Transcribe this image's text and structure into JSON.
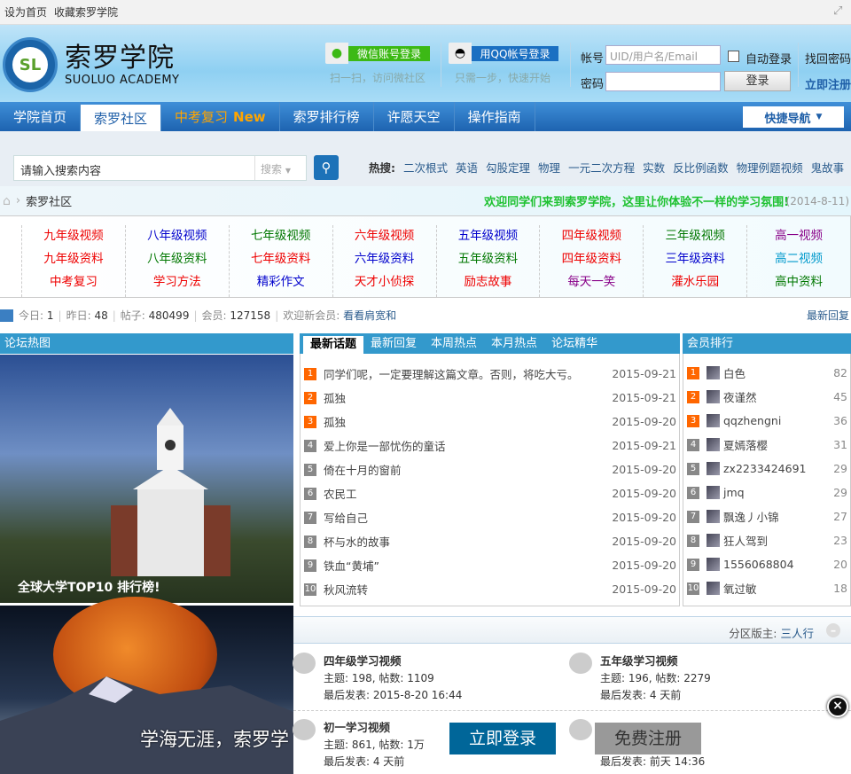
{
  "topbar": {
    "set_home": "设为首页",
    "favorite": "收藏索罗学院"
  },
  "logo": {
    "cn": "索罗学院",
    "en": "SUOLUO ACADEMY",
    "mark": "SL"
  },
  "social": {
    "wechat_label": "微信账号登录",
    "wechat_hint": "扫一扫，访问微社区",
    "qq_label": "用QQ帐号登录",
    "qq_hint": "只需一步，快速开始"
  },
  "login": {
    "account_label": "帐号",
    "account_placeholder": "UID/用户名/Email",
    "password_label": "密码",
    "auto_login": "自动登录",
    "submit": "登录",
    "find_password": "找回密码",
    "register": "立即注册"
  },
  "nav": {
    "items": [
      "学院首页",
      "索罗社区",
      "中考复习",
      "索罗排行榜",
      "许愿天空",
      "操作指南"
    ],
    "new_badge": "New",
    "quick_nav": "快捷导航"
  },
  "search": {
    "placeholder": "请输入搜索内容",
    "type": "搜索",
    "hot_label": "热搜:",
    "hot": [
      "二次根式",
      "英语",
      "勾股定理",
      "物理",
      "一元二次方程",
      "实数",
      "反比例函数",
      "物理例题视频",
      "鬼故事"
    ]
  },
  "breadcrumb": {
    "current": "索罗社区",
    "welcome": "欢迎同学们来到索罗学院，这里让你体验不一样的学习氛围!",
    "date": "(2014-8-11)"
  },
  "links": [
    [
      {
        "t": "九年级视频",
        "c": "#e00"
      },
      {
        "t": "九年级资料",
        "c": "#e00"
      },
      {
        "t": "中考复习",
        "c": "#e00"
      }
    ],
    [
      {
        "t": "八年级视频",
        "c": "#00c"
      },
      {
        "t": "八年级资料",
        "c": "#070"
      },
      {
        "t": "学习方法",
        "c": "#e00"
      }
    ],
    [
      {
        "t": "七年级视频",
        "c": "#070"
      },
      {
        "t": "七年级资料",
        "c": "#e00"
      },
      {
        "t": "精彩作文",
        "c": "#00c"
      }
    ],
    [
      {
        "t": "六年级视频",
        "c": "#e00"
      },
      {
        "t": "六年级资料",
        "c": "#00c"
      },
      {
        "t": "天才小侦探",
        "c": "#e00"
      }
    ],
    [
      {
        "t": "五年级视频",
        "c": "#00c"
      },
      {
        "t": "五年级资料",
        "c": "#070"
      },
      {
        "t": "励志故事",
        "c": "#e00"
      }
    ],
    [
      {
        "t": "四年级视频",
        "c": "#e00"
      },
      {
        "t": "四年级资料",
        "c": "#e00"
      },
      {
        "t": "每天一笑",
        "c": "#808"
      }
    ],
    [
      {
        "t": "三年级视频",
        "c": "#070"
      },
      {
        "t": "三年级资料",
        "c": "#00c"
      },
      {
        "t": "灌水乐园",
        "c": "#e00"
      }
    ],
    [
      {
        "t": "高一视频",
        "c": "#808"
      },
      {
        "t": "高二视频",
        "c": "#09c"
      },
      {
        "t": "高中资料",
        "c": "#070"
      }
    ]
  ],
  "stats": {
    "today_label": "今日:",
    "today": "1",
    "yesterday_label": "昨日:",
    "yesterday": "48",
    "posts_label": "帖子:",
    "posts": "480499",
    "members_label": "会员:",
    "members": "127158",
    "welcome_label": "欢迎新会员:",
    "newest": "看看肩宽和",
    "latest_reply": "最新回复"
  },
  "hotpic": {
    "title": "论坛热图",
    "caption": "全球大学TOP10 排行榜!"
  },
  "topics": {
    "tabs": [
      "最新话题",
      "最新回复",
      "本周热点",
      "本月热点",
      "论坛精华"
    ],
    "items": [
      {
        "n": "1",
        "t": "同学们呢，一定要理解这篇文章。否则，将吃大亏。",
        "d": "2015-09-21"
      },
      {
        "n": "2",
        "t": "孤独",
        "d": "2015-09-21"
      },
      {
        "n": "3",
        "t": "孤独",
        "d": "2015-09-20"
      },
      {
        "n": "4",
        "t": "爱上你是一部忧伤的童话",
        "d": "2015-09-21"
      },
      {
        "n": "5",
        "t": "倚在十月的窗前",
        "d": "2015-09-20"
      },
      {
        "n": "6",
        "t": "农民工",
        "d": "2015-09-20"
      },
      {
        "n": "7",
        "t": "写给自己",
        "d": "2015-09-20"
      },
      {
        "n": "8",
        "t": "杯与水的故事",
        "d": "2015-09-20"
      },
      {
        "n": "9",
        "t": "铁血“黄埔”",
        "d": "2015-09-20"
      },
      {
        "n": "10",
        "t": "秋风流转",
        "d": "2015-09-20"
      }
    ]
  },
  "ranking": {
    "title": "会员排行",
    "items": [
      {
        "n": "1",
        "name": "白色",
        "v": "82"
      },
      {
        "n": "2",
        "name": "夜谨然",
        "v": "45"
      },
      {
        "n": "3",
        "name": "qqzhengni",
        "v": "36"
      },
      {
        "n": "4",
        "name": "夏嫣落樱",
        "v": "31"
      },
      {
        "n": "5",
        "name": "zx2233424691",
        "v": "29"
      },
      {
        "n": "6",
        "name": "jmq",
        "v": "29"
      },
      {
        "n": "7",
        "name": "飘逸丿小锦",
        "v": "27"
      },
      {
        "n": "8",
        "name": "狂人驾到",
        "v": "23"
      },
      {
        "n": "9",
        "name": "1556068804",
        "v": "20"
      },
      {
        "n": "10",
        "name": "氧过敏",
        "v": "18"
      }
    ]
  },
  "section": {
    "moderator_label": "分区版主:",
    "moderator": "三人行",
    "forums": [
      {
        "name": "四年级学习视频",
        "stats": "主题: 198, 帖数: 1109",
        "last": "最后发表: 2015-8-20 16:44"
      },
      {
        "name": "五年级学习视频",
        "stats": "主题: 196, 帖数: 2279",
        "last": "最后发表: 4 天前"
      },
      {
        "name": "初一学习视频",
        "stats": "主题: 861, 帖数: 1万",
        "last": "最后发表: 4 天前"
      },
      {
        "name": "",
        "stats": "",
        "last": "最后发表: 前天 14:36"
      }
    ]
  },
  "overlay": {
    "slogan": "学海无涯，索罗学",
    "login": "立即登录",
    "register": "免费注册",
    "close": "×"
  }
}
